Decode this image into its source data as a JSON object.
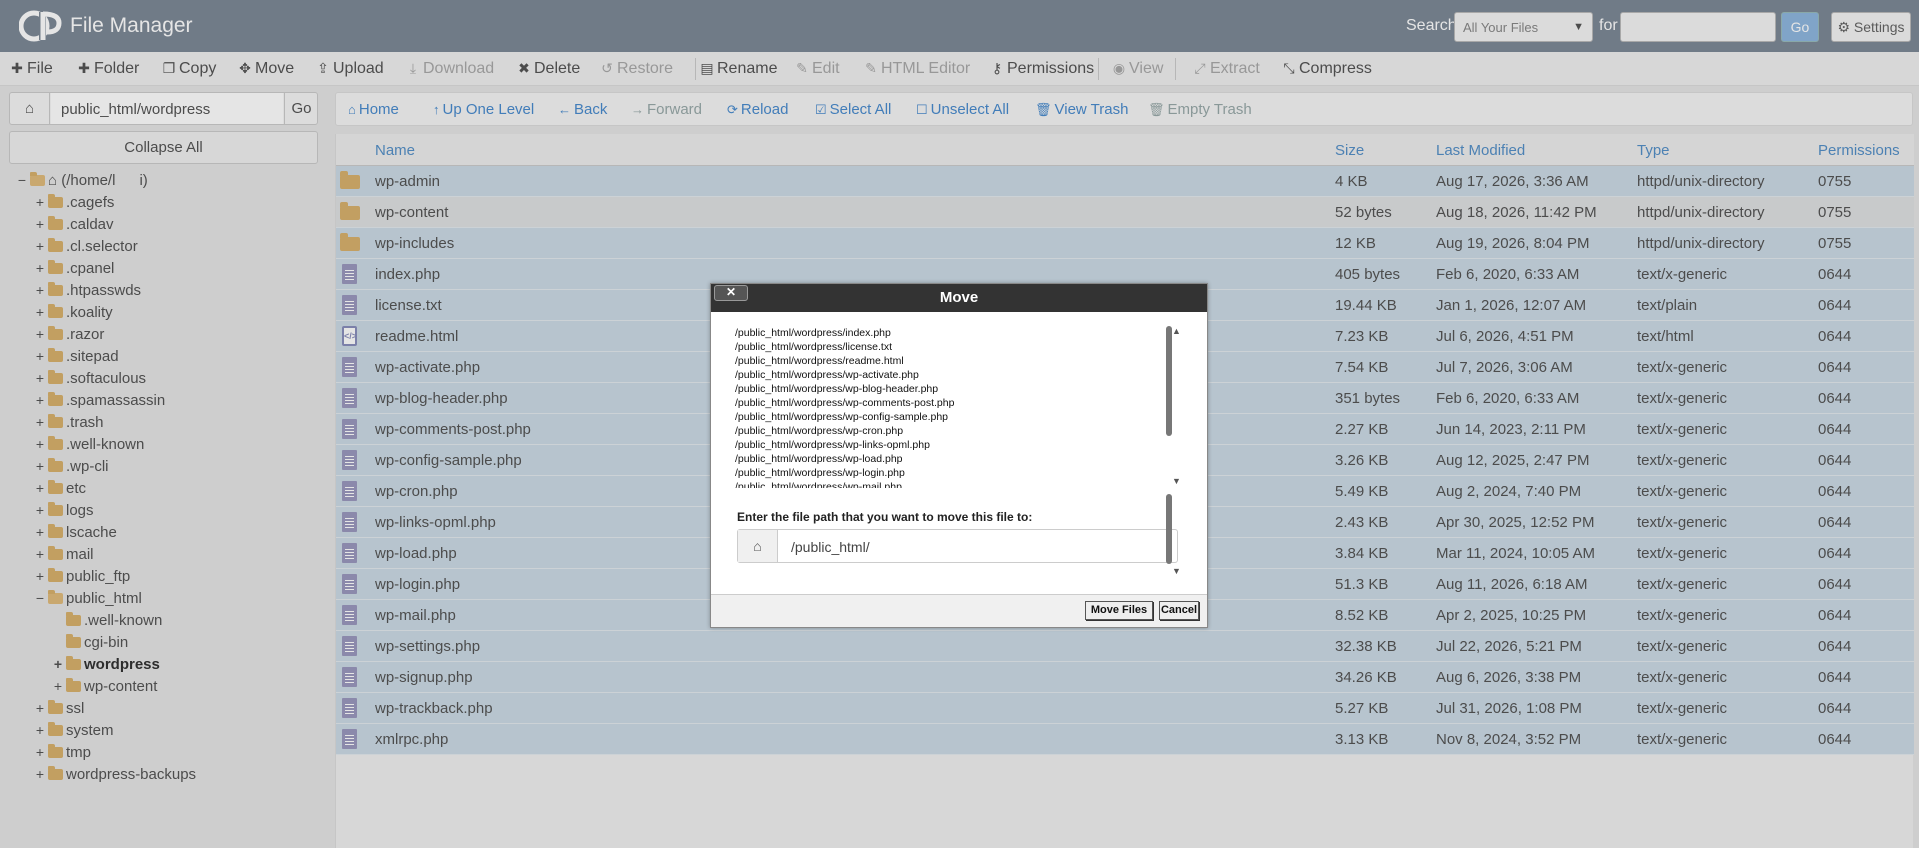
{
  "header": {
    "app_title": "File Manager",
    "search_label": "Search",
    "search_scope": "All Your Files",
    "for_label": "for",
    "search_value": "",
    "go_label": "Go",
    "settings_label": "Settings"
  },
  "toolbar": [
    {
      "label": "File",
      "icon": "plus-icon",
      "glyph": "✚",
      "enabled": true
    },
    {
      "label": "Folder",
      "icon": "plus-icon",
      "glyph": "✚",
      "enabled": true
    },
    {
      "label": "Copy",
      "icon": "copy-icon",
      "glyph": "❐",
      "enabled": true
    },
    {
      "label": "Move",
      "icon": "move-icon",
      "glyph": "✥",
      "enabled": true
    },
    {
      "label": "Upload",
      "icon": "upload-icon",
      "glyph": "⇪",
      "enabled": true
    },
    {
      "label": "Download",
      "icon": "download-icon",
      "glyph": "⤓",
      "enabled": false
    },
    {
      "label": "Delete",
      "icon": "delete-icon",
      "glyph": "✖",
      "enabled": true
    },
    {
      "label": "Restore",
      "icon": "restore-icon",
      "glyph": "↺",
      "enabled": false
    },
    {
      "label": "Rename",
      "icon": "rename-icon",
      "glyph": "▤",
      "enabled": true
    },
    {
      "label": "Edit",
      "icon": "edit-icon",
      "glyph": "✎",
      "enabled": false
    },
    {
      "label": "HTML Editor",
      "icon": "html-editor-icon",
      "glyph": "✎",
      "enabled": false
    },
    {
      "label": "Permissions",
      "icon": "key-icon",
      "glyph": "⚷",
      "enabled": true
    },
    {
      "label": "View",
      "icon": "eye-icon",
      "glyph": "◉",
      "enabled": false
    },
    {
      "label": "Extract",
      "icon": "extract-icon",
      "glyph": "⤢",
      "enabled": false
    },
    {
      "label": "Compress",
      "icon": "compress-icon",
      "glyph": "⤡",
      "enabled": true
    }
  ],
  "left_panel": {
    "path_value": "public_html/wordpress",
    "go_label": "Go",
    "collapse_label": "Collapse All"
  },
  "tree": [
    {
      "label": "(/home/l        i)",
      "toggle": "−",
      "depth": 0,
      "home": true
    },
    {
      "label": ".cagefs",
      "toggle": "+",
      "depth": 1
    },
    {
      "label": ".caldav",
      "toggle": "+",
      "depth": 1
    },
    {
      "label": ".cl.selector",
      "toggle": "+",
      "depth": 1
    },
    {
      "label": ".cpanel",
      "toggle": "+",
      "depth": 1
    },
    {
      "label": ".htpasswds",
      "toggle": "+",
      "depth": 1
    },
    {
      "label": ".koality",
      "toggle": "+",
      "depth": 1
    },
    {
      "label": ".razor",
      "toggle": "+",
      "depth": 1
    },
    {
      "label": ".sitepad",
      "toggle": "+",
      "depth": 1
    },
    {
      "label": ".softaculous",
      "toggle": "+",
      "depth": 1
    },
    {
      "label": ".spamassassin",
      "toggle": "+",
      "depth": 1
    },
    {
      "label": ".trash",
      "toggle": "+",
      "depth": 1
    },
    {
      "label": ".well-known",
      "toggle": "+",
      "depth": 1
    },
    {
      "label": ".wp-cli",
      "toggle": "+",
      "depth": 1
    },
    {
      "label": "etc",
      "toggle": "+",
      "depth": 1
    },
    {
      "label": "logs",
      "toggle": "+",
      "depth": 1
    },
    {
      "label": "lscache",
      "toggle": "+",
      "depth": 1
    },
    {
      "label": "mail",
      "toggle": "+",
      "depth": 1
    },
    {
      "label": "public_ftp",
      "toggle": "+",
      "depth": 1
    },
    {
      "label": "public_html",
      "toggle": "−",
      "depth": 1,
      "open": true
    },
    {
      "label": ".well-known",
      "toggle": "",
      "depth": 2
    },
    {
      "label": "cgi-bin",
      "toggle": "",
      "depth": 2
    },
    {
      "label": "wordpress",
      "toggle": "+",
      "depth": 2,
      "bold": true
    },
    {
      "label": "wp-content",
      "toggle": "+",
      "depth": 2
    },
    {
      "label": "ssl",
      "toggle": "+",
      "depth": 1
    },
    {
      "label": "system",
      "toggle": "+",
      "depth": 1
    },
    {
      "label": "tmp",
      "toggle": "+",
      "depth": 1
    },
    {
      "label": "wordpress-backups",
      "toggle": "+",
      "depth": 1
    }
  ],
  "nav": [
    {
      "label": "Home",
      "icon": "home-icon",
      "glyph": "⌂",
      "enabled": true
    },
    {
      "label": "Up One Level",
      "icon": "up-level-icon",
      "glyph": "↑",
      "enabled": true
    },
    {
      "label": "Back",
      "icon": "back-icon",
      "glyph": "←",
      "enabled": true
    },
    {
      "label": "Forward",
      "icon": "forward-icon",
      "glyph": "→",
      "enabled": false
    },
    {
      "label": "Reload",
      "icon": "reload-icon",
      "glyph": "⟳",
      "enabled": true
    },
    {
      "label": "Select All",
      "icon": "checkbox-checked-icon",
      "glyph": "☑",
      "enabled": true
    },
    {
      "label": "Unselect All",
      "icon": "checkbox-empty-icon",
      "glyph": "☐",
      "enabled": true
    },
    {
      "label": "View Trash",
      "icon": "trash-icon",
      "glyph": "🗑",
      "enabled": true
    },
    {
      "label": "Empty Trash",
      "icon": "trash-icon",
      "glyph": "🗑",
      "enabled": false
    }
  ],
  "table": {
    "columns": [
      "Name",
      "Size",
      "Last Modified",
      "Type",
      "Permissions"
    ],
    "rows": [
      {
        "name": "wp-admin",
        "size": "4 KB",
        "modified": "Aug 17, 2026, 3:36 AM",
        "type": "httpd/unix-directory",
        "perms": "0755",
        "kind": "folder",
        "selected": true
      },
      {
        "name": "wp-content",
        "size": "52 bytes",
        "modified": "Aug 18, 2026, 11:42 PM",
        "type": "httpd/unix-directory",
        "perms": "0755",
        "kind": "folder",
        "selected": false
      },
      {
        "name": "wp-includes",
        "size": "12 KB",
        "modified": "Aug 19, 2026, 8:04 PM",
        "type": "httpd/unix-directory",
        "perms": "0755",
        "kind": "folder",
        "selected": true
      },
      {
        "name": "index.php",
        "size": "405 bytes",
        "modified": "Feb 6, 2020, 6:33 AM",
        "type": "text/x-generic",
        "perms": "0644",
        "kind": "doc",
        "selected": true
      },
      {
        "name": "license.txt",
        "size": "19.44 KB",
        "modified": "Jan 1, 2026, 12:07 AM",
        "type": "text/plain",
        "perms": "0644",
        "kind": "doc",
        "selected": true
      },
      {
        "name": "readme.html",
        "size": "7.23 KB",
        "modified": "Jul 6, 2026, 4:51 PM",
        "type": "text/html",
        "perms": "0644",
        "kind": "html",
        "selected": true
      },
      {
        "name": "wp-activate.php",
        "size": "7.54 KB",
        "modified": "Jul 7, 2026, 3:06 AM",
        "type": "text/x-generic",
        "perms": "0644",
        "kind": "doc",
        "selected": true
      },
      {
        "name": "wp-blog-header.php",
        "size": "351 bytes",
        "modified": "Feb 6, 2020, 6:33 AM",
        "type": "text/x-generic",
        "perms": "0644",
        "kind": "doc",
        "selected": true
      },
      {
        "name": "wp-comments-post.php",
        "size": "2.27 KB",
        "modified": "Jun 14, 2023, 2:11 PM",
        "type": "text/x-generic",
        "perms": "0644",
        "kind": "doc",
        "selected": true
      },
      {
        "name": "wp-config-sample.php",
        "size": "3.26 KB",
        "modified": "Aug 12, 2025, 2:47 PM",
        "type": "text/x-generic",
        "perms": "0644",
        "kind": "doc",
        "selected": true
      },
      {
        "name": "wp-cron.php",
        "size": "5.49 KB",
        "modified": "Aug 2, 2024, 7:40 PM",
        "type": "text/x-generic",
        "perms": "0644",
        "kind": "doc",
        "selected": true
      },
      {
        "name": "wp-links-opml.php",
        "size": "2.43 KB",
        "modified": "Apr 30, 2025, 12:52 PM",
        "type": "text/x-generic",
        "perms": "0644",
        "kind": "doc",
        "selected": true
      },
      {
        "name": "wp-load.php",
        "size": "3.84 KB",
        "modified": "Mar 11, 2024, 10:05 AM",
        "type": "text/x-generic",
        "perms": "0644",
        "kind": "doc",
        "selected": true
      },
      {
        "name": "wp-login.php",
        "size": "51.3 KB",
        "modified": "Aug 11, 2026, 6:18 AM",
        "type": "text/x-generic",
        "perms": "0644",
        "kind": "doc",
        "selected": true
      },
      {
        "name": "wp-mail.php",
        "size": "8.52 KB",
        "modified": "Apr 2, 2025, 10:25 PM",
        "type": "text/x-generic",
        "perms": "0644",
        "kind": "doc",
        "selected": true
      },
      {
        "name": "wp-settings.php",
        "size": "32.38 KB",
        "modified": "Jul 22, 2026, 5:21 PM",
        "type": "text/x-generic",
        "perms": "0644",
        "kind": "doc",
        "selected": true
      },
      {
        "name": "wp-signup.php",
        "size": "34.26 KB",
        "modified": "Aug 6, 2026, 3:38 PM",
        "type": "text/x-generic",
        "perms": "0644",
        "kind": "doc",
        "selected": true
      },
      {
        "name": "wp-trackback.php",
        "size": "5.27 KB",
        "modified": "Jul 31, 2026, 1:08 PM",
        "type": "text/x-generic",
        "perms": "0644",
        "kind": "doc",
        "selected": true
      },
      {
        "name": "xmlrpc.php",
        "size": "3.13 KB",
        "modified": "Nov 8, 2024, 3:52 PM",
        "type": "text/x-generic",
        "perms": "0644",
        "kind": "doc",
        "selected": true
      }
    ]
  },
  "modal": {
    "title": "Move",
    "close_label": "✕",
    "files": [
      "/public_html/wordpress/index.php",
      "/public_html/wordpress/license.txt",
      "/public_html/wordpress/readme.html",
      "/public_html/wordpress/wp-activate.php",
      "/public_html/wordpress/wp-blog-header.php",
      "/public_html/wordpress/wp-comments-post.php",
      "/public_html/wordpress/wp-config-sample.php",
      "/public_html/wordpress/wp-cron.php",
      "/public_html/wordpress/wp-links-opml.php",
      "/public_html/wordpress/wp-load.php",
      "/public_html/wordpress/wp-login.php",
      "/public_html/wordpress/wp-mail.php"
    ],
    "prompt": "Enter the file path that you want to move this file to:",
    "destination": "/public_html/",
    "move_label": "Move Files",
    "cancel_label": "Cancel"
  },
  "colors": {
    "header_bg": "#7d8997",
    "link_blue": "#4a8ccf",
    "selected_row": "#ccdbe6",
    "folder": "#d9b26e"
  }
}
